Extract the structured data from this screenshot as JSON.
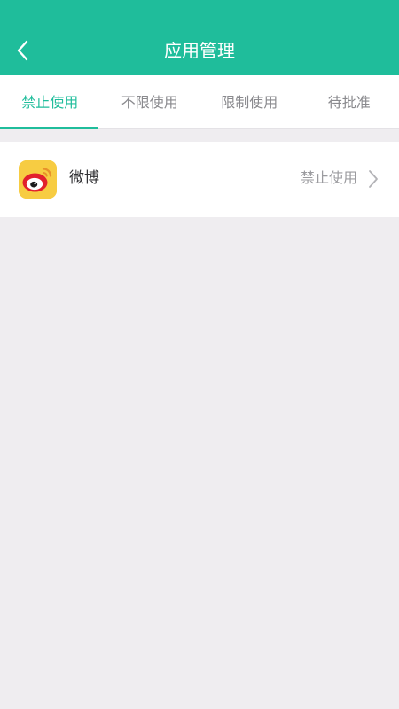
{
  "header": {
    "title": "应用管理",
    "back_icon": "chevron-left-icon",
    "background_color": "#1fbd9b"
  },
  "tabs": [
    {
      "label": "禁止使用",
      "active": true
    },
    {
      "label": "不限使用",
      "active": false
    },
    {
      "label": "限制使用",
      "active": false
    },
    {
      "label": "待批准",
      "active": false
    }
  ],
  "apps": [
    {
      "name": "微博",
      "icon": "weibo-icon",
      "status": "禁止使用",
      "chevron_icon": "chevron-right-icon"
    }
  ],
  "colors": {
    "accent": "#1fbd9b",
    "page_background": "#efedf0",
    "tab_inactive": "#8a8a8e",
    "status_text": "#9b9b9f"
  }
}
